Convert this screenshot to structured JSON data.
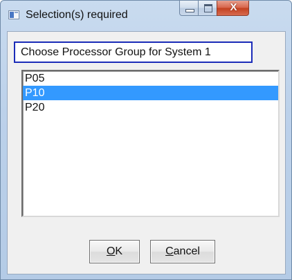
{
  "window": {
    "title": "Selection(s) required",
    "close_glyph": "X"
  },
  "dialog": {
    "prompt": "Choose Processor Group for System 1",
    "list_items": [
      "P05",
      "P10",
      "P20"
    ],
    "selected_index": 1
  },
  "buttons": {
    "ok": {
      "mnemonic": "O",
      "rest": "K"
    },
    "cancel": {
      "mnemonic": "C",
      "rest": "ancel"
    }
  },
  "colors": {
    "selection": "#3399ff",
    "prompt_border": "#1a2bb8",
    "close_button": "#c3401f"
  },
  "icons": [
    "app-icon",
    "minimize-icon",
    "maximize-icon",
    "close-icon"
  ]
}
